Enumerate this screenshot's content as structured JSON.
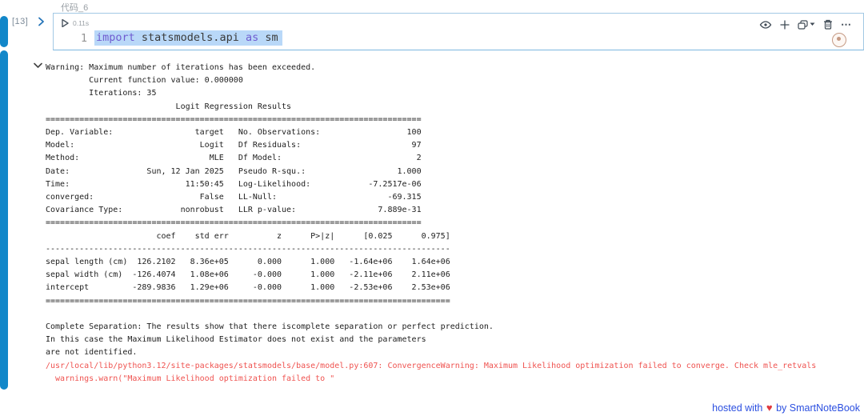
{
  "cell": {
    "title": "代码_6",
    "execution_count": "[13]",
    "run_time": "0.11s",
    "line_number": "1",
    "code_text": "import statsmodels.api as sm",
    "code_tokens": [
      {
        "text": "import ",
        "type": "keyword"
      },
      {
        "text": "statsmodels.api ",
        "type": "plain"
      },
      {
        "text": "as ",
        "type": "keyword"
      },
      {
        "text": "sm",
        "type": "plain"
      }
    ],
    "toolbar_icons": [
      "visibility",
      "add",
      "duplicate-with-menu",
      "delete",
      "more"
    ],
    "more_glyph": "⋯"
  },
  "output": {
    "text": "Warning: Maximum number of iterations has been exceeded.\n         Current function value: 0.000000\n         Iterations: 35\n                           Logit Regression Results                           \n==============================================================================\nDep. Variable:                 target   No. Observations:                  100\nModel:                          Logit   Df Residuals:                       97\nMethod:                           MLE   Df Model:                            2\nDate:                Sun, 12 Jan 2025   Pseudo R-squ.:                   1.000\nTime:                        11:50:45   Log-Likelihood:            -7.2517e-06\nconverged:                      False   LL-Null:                       -69.315\nCovariance Type:            nonrobust   LLR p-value:                 7.889e-31\n==============================================================================\n                       coef    std err          z      P>|z|      [0.025      0.975]\n------------------------------------------------------------------------------------\nsepal length (cm)  126.2102   8.36e+05      0.000      1.000   -1.64e+06    1.64e+06\nsepal width (cm)  -126.4074   1.08e+06     -0.000      1.000   -2.11e+06    2.11e+06\nintercept         -289.9836   1.29e+06     -0.000      1.000   -2.53e+06    2.53e+06\n====================================================================================\n\nComplete Separation: The results show that there iscomplete separation or perfect prediction.\nIn this case the Maximum Likelihood Estimator does not exist and the parameters\nare not identified.",
    "stderr_text": "/usr/local/lib/python3.12/site-packages/statsmodels/base/model.py:607: ConvergenceWarning: Maximum Likelihood optimization failed to converge. Check mle_retvals\n  warnings.warn(\"Maximum Likelihood optimization failed to \""
  },
  "footer": {
    "prefix": "hosted with",
    "heart": "♥",
    "suffix": "by SmartNoteBook"
  },
  "colors": {
    "focus_bar": "#1287c9",
    "cell_border": "#a3c9e4",
    "code_selection": "#b9d8f8",
    "keyword": "#6f5bd0",
    "stderr_red": "#ef5350",
    "footer_blue": "#2b4fe0",
    "heart_red": "#e0393e"
  }
}
